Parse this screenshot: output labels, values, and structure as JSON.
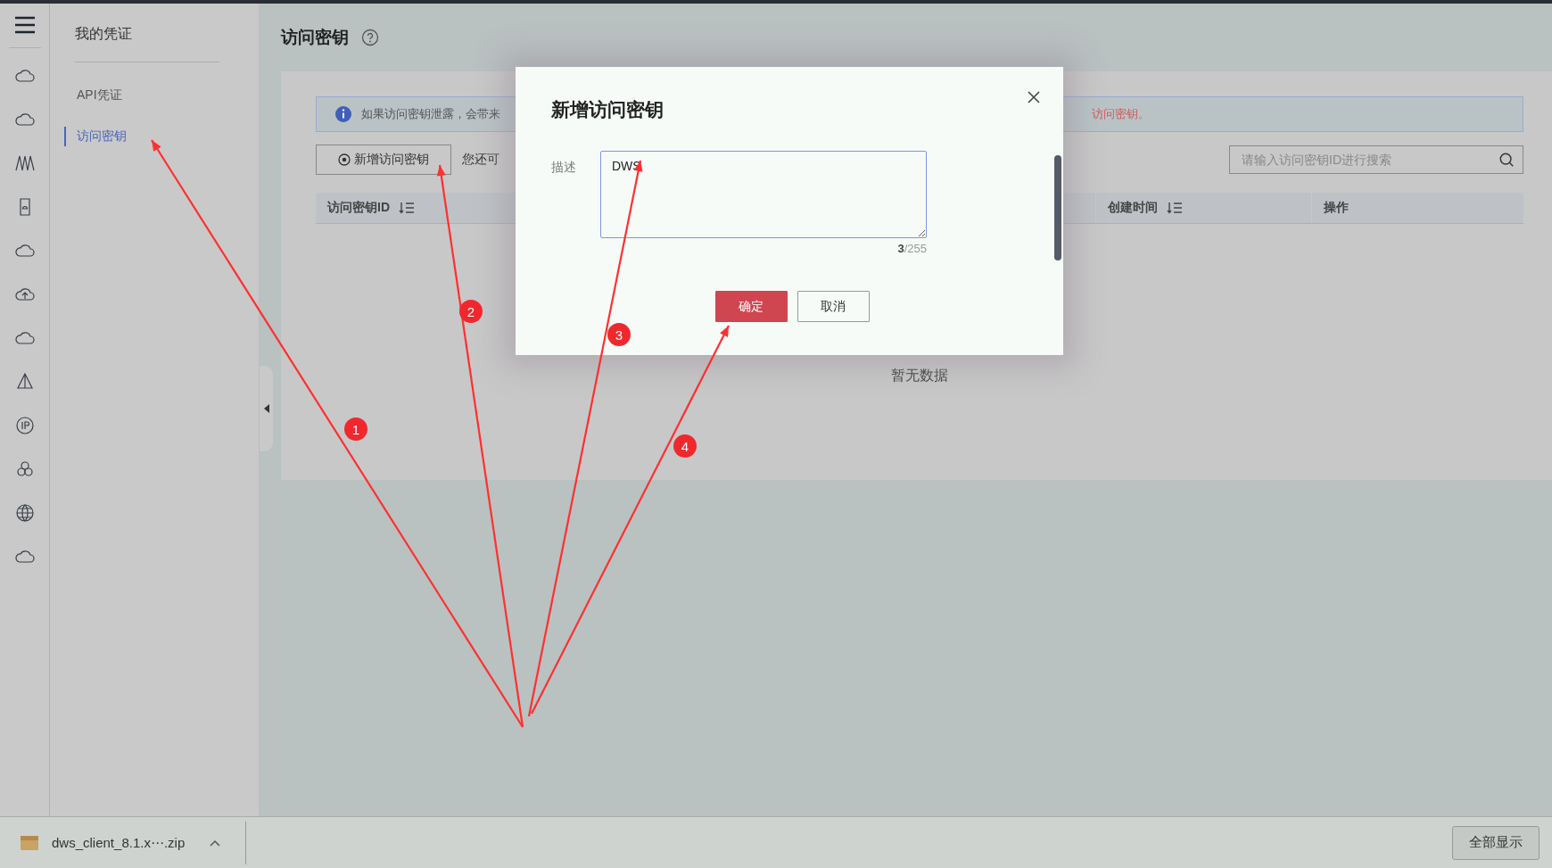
{
  "nav": {
    "title": "我的凭证",
    "items": [
      {
        "label": "API凭证",
        "selected": false
      },
      {
        "label": "访问密钥",
        "selected": true
      }
    ]
  },
  "page": {
    "title": "访问密钥"
  },
  "notice": {
    "text_start": "如果访问密钥泄露，会带来",
    "text_end": "访问密钥。"
  },
  "toolbar": {
    "add_button": "新增访问密钥",
    "quota_text": "您还可",
    "search": {
      "placeholder": "请输入访问密钥ID进行搜索"
    }
  },
  "table": {
    "columns": [
      {
        "label": "访问密钥ID",
        "sortable": true
      },
      {
        "label": "创建时间",
        "sortable": true
      },
      {
        "label": "操作",
        "sortable": false
      }
    ],
    "empty_text": "暂无数据"
  },
  "dialog": {
    "title": "新增访问密钥",
    "field_label": "描述",
    "value": "DWS",
    "counter": "**3**/255",
    "buttons": [
      {
        "label": "确定",
        "kind": "primary"
      },
      {
        "label": "取消",
        "kind": "default"
      }
    ]
  },
  "annotations": [
    {
      "number": "1"
    },
    {
      "number": "2"
    },
    {
      "number": "3"
    },
    {
      "number": "4"
    }
  ],
  "downloads": {
    "file": "dws_client_8.1.x⋯.zip",
    "show_all": "全部显示"
  }
}
